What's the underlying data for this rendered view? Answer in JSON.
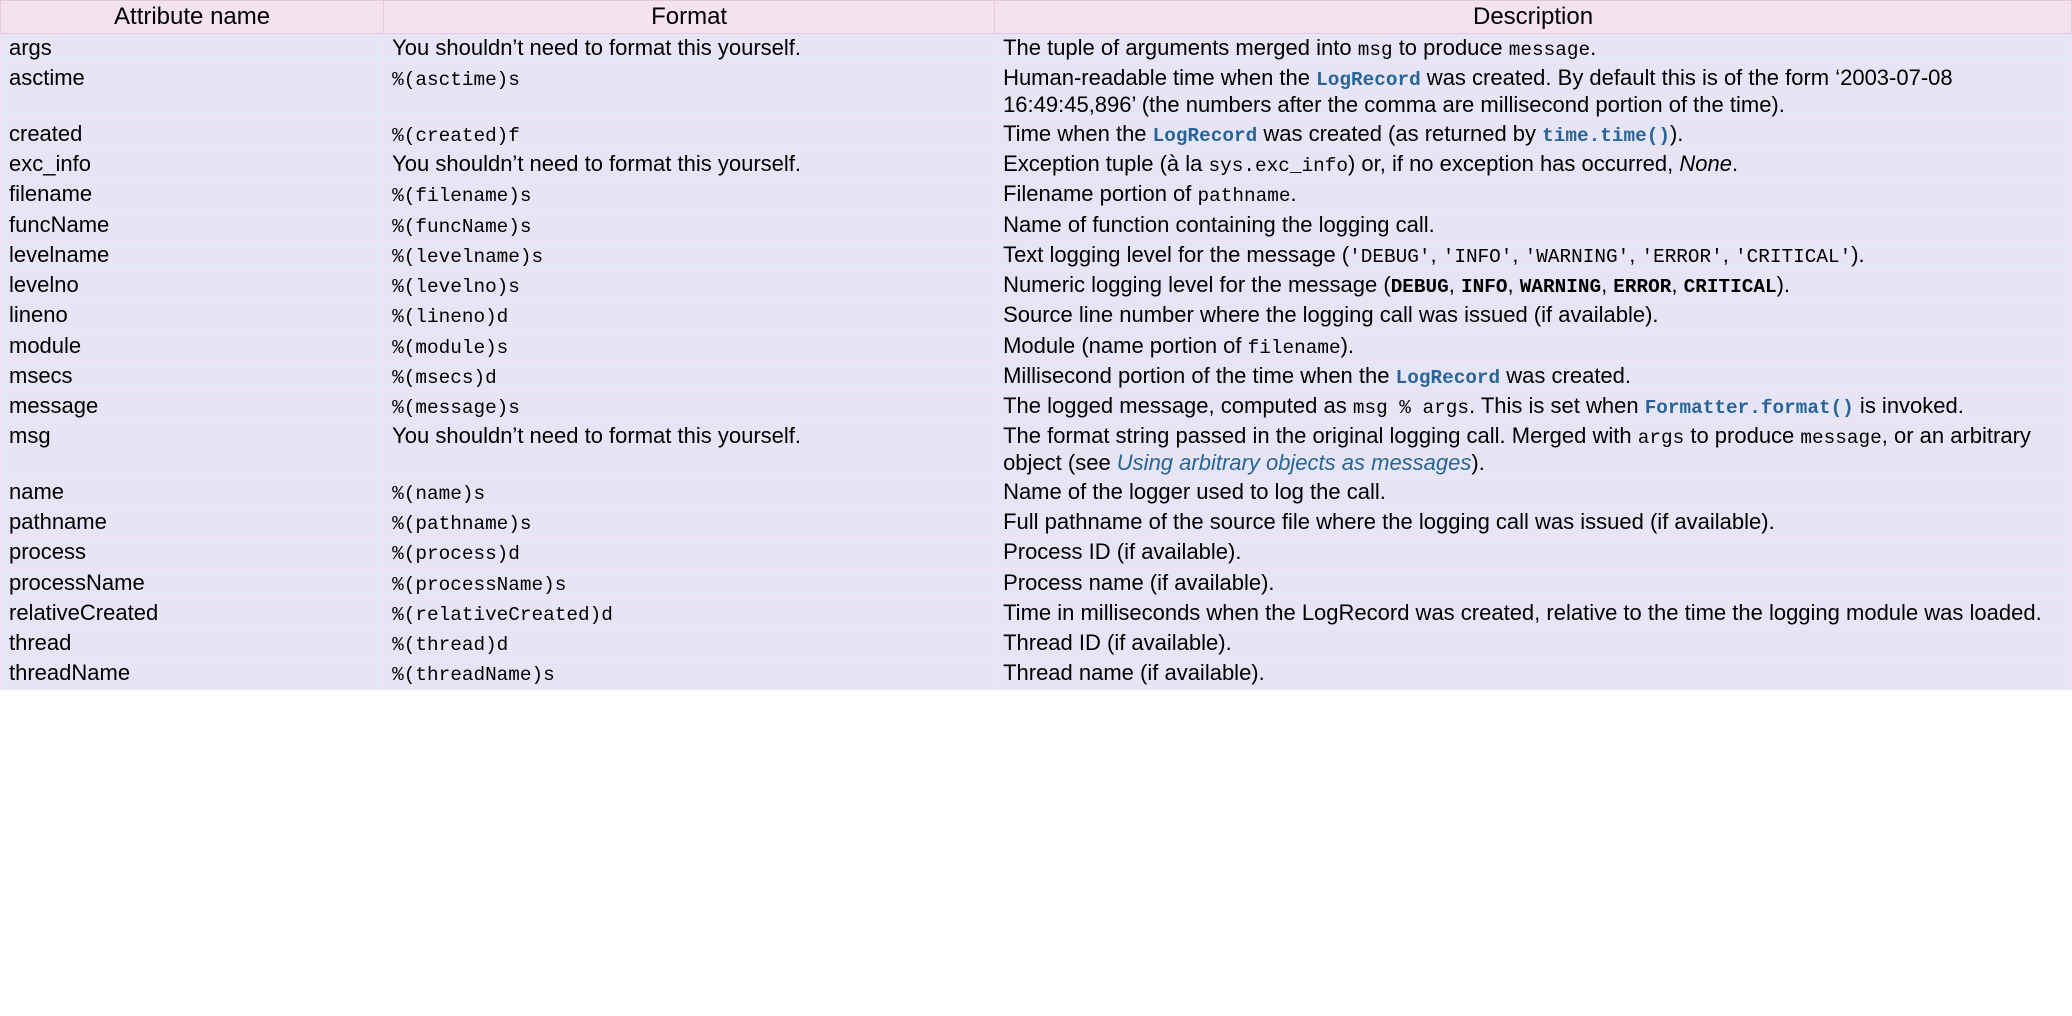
{
  "headers": {
    "attr": "Attribute name",
    "format": "Format",
    "desc": "Description"
  },
  "strings": {
    "no_format": "You shouldn’t need to format this yourself."
  },
  "rows": [
    {
      "name": "args",
      "format_ref": "no_format",
      "desc": [
        {
          "t": "text",
          "v": "The tuple of arguments merged into "
        },
        {
          "t": "code",
          "v": "msg"
        },
        {
          "t": "text",
          "v": " to produce "
        },
        {
          "t": "code",
          "v": "message"
        },
        {
          "t": "text",
          "v": "."
        }
      ]
    },
    {
      "name": "asctime",
      "format": "%(asctime)s",
      "desc": [
        {
          "t": "text",
          "v": "Human-readable time when the "
        },
        {
          "t": "codelink",
          "v": "LogRecord"
        },
        {
          "t": "text",
          "v": " was created. By default this is of the form ‘2003-07-08 16:49:45,896’ (the numbers after the comma are millisecond portion of the time)."
        }
      ]
    },
    {
      "name": "created",
      "format": "%(created)f",
      "desc": [
        {
          "t": "text",
          "v": "Time when the "
        },
        {
          "t": "codelink",
          "v": "LogRecord"
        },
        {
          "t": "text",
          "v": " was created (as returned by "
        },
        {
          "t": "codelink",
          "v": "time.time()"
        },
        {
          "t": "text",
          "v": ")."
        }
      ]
    },
    {
      "name": "exc_info",
      "format_ref": "no_format",
      "desc": [
        {
          "t": "text",
          "v": "Exception tuple (à la "
        },
        {
          "t": "code",
          "v": "sys.exc_info"
        },
        {
          "t": "text",
          "v": ") or, if no exception has occurred, "
        },
        {
          "t": "em",
          "v": "None"
        },
        {
          "t": "text",
          "v": "."
        }
      ]
    },
    {
      "name": "filename",
      "format": "%(filename)s",
      "desc": [
        {
          "t": "text",
          "v": "Filename portion of "
        },
        {
          "t": "code",
          "v": "pathname"
        },
        {
          "t": "text",
          "v": "."
        }
      ]
    },
    {
      "name": "funcName",
      "format": "%(funcName)s",
      "desc": [
        {
          "t": "text",
          "v": "Name of function containing the logging call."
        }
      ]
    },
    {
      "name": "levelname",
      "format": "%(levelname)s",
      "desc": [
        {
          "t": "text",
          "v": "Text logging level for the message ("
        },
        {
          "t": "code",
          "v": "'DEBUG'"
        },
        {
          "t": "text",
          "v": ", "
        },
        {
          "t": "code",
          "v": "'INFO'"
        },
        {
          "t": "text",
          "v": ", "
        },
        {
          "t": "code",
          "v": "'WARNING'"
        },
        {
          "t": "text",
          "v": ", "
        },
        {
          "t": "code",
          "v": "'ERROR'"
        },
        {
          "t": "text",
          "v": ", "
        },
        {
          "t": "code",
          "v": "'CRITICAL'"
        },
        {
          "t": "text",
          "v": ")."
        }
      ]
    },
    {
      "name": "levelno",
      "format": "%(levelno)s",
      "desc": [
        {
          "t": "text",
          "v": "Numeric logging level for the message ("
        },
        {
          "t": "codestrong",
          "v": "DEBUG"
        },
        {
          "t": "text",
          "v": ", "
        },
        {
          "t": "codestrong",
          "v": "INFO"
        },
        {
          "t": "text",
          "v": ", "
        },
        {
          "t": "codestrong",
          "v": "WARNING"
        },
        {
          "t": "text",
          "v": ", "
        },
        {
          "t": "codestrong",
          "v": "ERROR"
        },
        {
          "t": "text",
          "v": ", "
        },
        {
          "t": "codestrong",
          "v": "CRITICAL"
        },
        {
          "t": "text",
          "v": ")."
        }
      ]
    },
    {
      "name": "lineno",
      "format": "%(lineno)d",
      "desc": [
        {
          "t": "text",
          "v": "Source line number where the logging call was issued (if available)."
        }
      ]
    },
    {
      "name": "module",
      "format": "%(module)s",
      "desc": [
        {
          "t": "text",
          "v": "Module (name portion of "
        },
        {
          "t": "code",
          "v": "filename"
        },
        {
          "t": "text",
          "v": ")."
        }
      ]
    },
    {
      "name": "msecs",
      "format": "%(msecs)d",
      "desc": [
        {
          "t": "text",
          "v": "Millisecond portion of the time when the "
        },
        {
          "t": "codelink",
          "v": "LogRecord"
        },
        {
          "t": "text",
          "v": " was created."
        }
      ]
    },
    {
      "name": "message",
      "format": "%(message)s",
      "desc": [
        {
          "t": "text",
          "v": "The logged message, computed as "
        },
        {
          "t": "code",
          "v": "msg % args"
        },
        {
          "t": "text",
          "v": ". This is set when "
        },
        {
          "t": "codelink",
          "v": "Formatter.format()"
        },
        {
          "t": "text",
          "v": " is invoked."
        }
      ]
    },
    {
      "name": "msg",
      "format_ref": "no_format",
      "desc": [
        {
          "t": "text",
          "v": "The format string passed in the original logging call. Merged with "
        },
        {
          "t": "code",
          "v": "args"
        },
        {
          "t": "text",
          "v": " to produce "
        },
        {
          "t": "code",
          "v": "message"
        },
        {
          "t": "text",
          "v": ", or an arbitrary object (see "
        },
        {
          "t": "link",
          "v": "Using arbitrary objects as messages"
        },
        {
          "t": "text",
          "v": ")."
        }
      ]
    },
    {
      "name": "name",
      "format": "%(name)s",
      "desc": [
        {
          "t": "text",
          "v": "Name of the logger used to log the call."
        }
      ]
    },
    {
      "name": "pathname",
      "format": "%(pathname)s",
      "desc": [
        {
          "t": "text",
          "v": "Full pathname of the source file where the logging call was issued (if available)."
        }
      ]
    },
    {
      "name": "process",
      "format": "%(process)d",
      "desc": [
        {
          "t": "text",
          "v": "Process ID (if available)."
        }
      ]
    },
    {
      "name": "processName",
      "format": "%(processName)s",
      "desc": [
        {
          "t": "text",
          "v": "Process name (if available)."
        }
      ]
    },
    {
      "name": "relativeCreated",
      "format": "%(relativeCreated)d",
      "desc": [
        {
          "t": "text",
          "v": "Time in milliseconds when the LogRecord was created, relative to the time the logging module was loaded."
        }
      ]
    },
    {
      "name": "thread",
      "format": "%(thread)d",
      "desc": [
        {
          "t": "text",
          "v": "Thread ID (if available)."
        }
      ]
    },
    {
      "name": "threadName",
      "format": "%(threadName)s",
      "desc": [
        {
          "t": "text",
          "v": "Thread name (if available)."
        }
      ]
    }
  ]
}
